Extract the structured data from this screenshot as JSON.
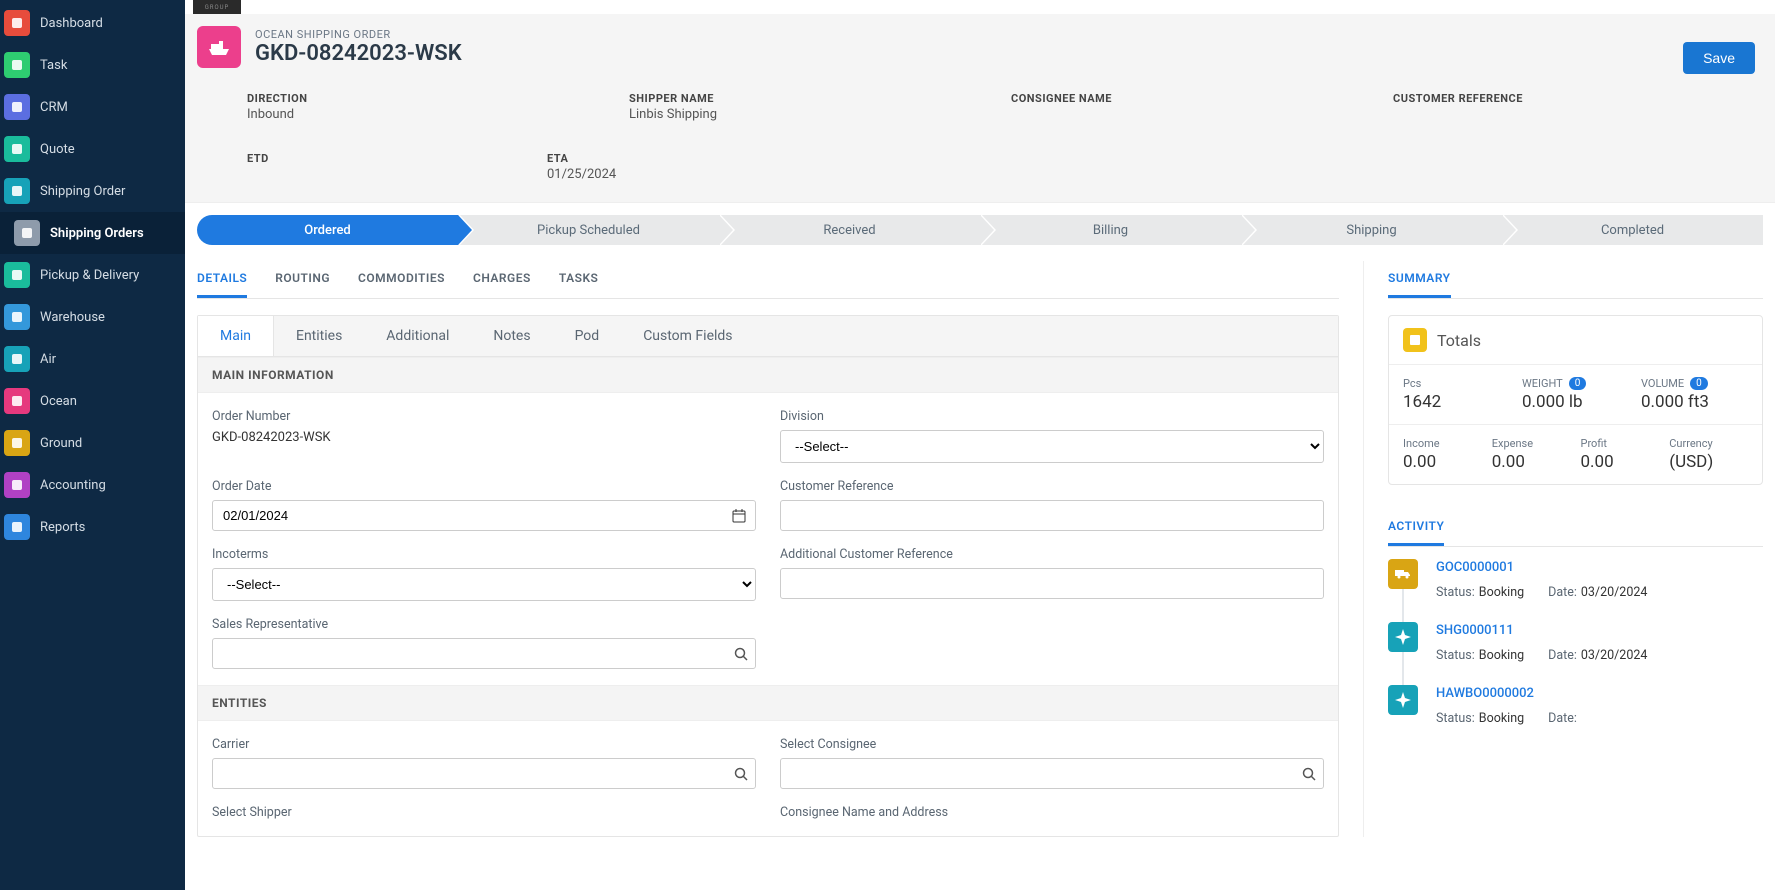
{
  "sidebar": {
    "items": [
      {
        "label": "Dashboard",
        "color": "#e74c3c"
      },
      {
        "label": "Task",
        "color": "#2ecc71"
      },
      {
        "label": "CRM",
        "color": "#5b6ee1"
      },
      {
        "label": "Quote",
        "color": "#1abc9c"
      },
      {
        "label": "Shipping Order",
        "color": "#17a2b8"
      },
      {
        "label": "Shipping Orders",
        "color": "#8e9bab",
        "active": true
      },
      {
        "label": "Pickup & Delivery",
        "color": "#1abc9c"
      },
      {
        "label": "Warehouse",
        "color": "#3498db"
      },
      {
        "label": "Air",
        "color": "#17a2b8"
      },
      {
        "label": "Ocean",
        "color": "#e6397e"
      },
      {
        "label": "Ground",
        "color": "#d9a514"
      },
      {
        "label": "Accounting",
        "color": "#b041c4"
      },
      {
        "label": "Reports",
        "color": "#2e86de"
      }
    ]
  },
  "brand": "GROUP",
  "header": {
    "type": "OCEAN SHIPPING ORDER",
    "number": "GKD-08242023-WSK",
    "save": "Save",
    "fields": {
      "direction_label": "DIRECTION",
      "direction_value": "Inbound",
      "shipper_label": "SHIPPER NAME",
      "shipper_value": "Linbis Shipping",
      "consignee_label": "CONSIGNEE NAME",
      "consignee_value": "",
      "custref_label": "CUSTOMER REFERENCE",
      "custref_value": "",
      "etd_label": "ETD",
      "etd_value": "",
      "eta_label": "ETA",
      "eta_value": "01/25/2024"
    }
  },
  "progress": [
    "Ordered",
    "Pickup Scheduled",
    "Received",
    "Billing",
    "Shipping",
    "Completed"
  ],
  "tabs_upper": [
    "DETAILS",
    "ROUTING",
    "COMMODITIES",
    "CHARGES",
    "TASKS"
  ],
  "tabs_lower": [
    "Main",
    "Entities",
    "Additional",
    "Notes",
    "Pod",
    "Custom Fields"
  ],
  "sections": {
    "main_info": "MAIN INFORMATION",
    "entities": "ENTITIES"
  },
  "form": {
    "order_number_label": "Order Number",
    "order_number_value": "GKD-08242023-WSK",
    "division_label": "Division",
    "division_value": "--Select--",
    "order_date_label": "Order Date",
    "order_date_value": "02/01/2024",
    "custref_label": "Customer Reference",
    "incoterms_label": "Incoterms",
    "incoterms_value": "--Select--",
    "addref_label": "Additional Customer Reference",
    "salesrep_label": "Sales Representative",
    "carrier_label": "Carrier",
    "select_consignee_label": "Select Consignee",
    "select_shipper_label": "Select Shipper",
    "consignee_addr_label": "Consignee Name and Address"
  },
  "summary": {
    "tab": "SUMMARY",
    "totals_title": "Totals",
    "pcs_label": "Pcs",
    "pcs_value": "1642",
    "weight_label": "WEIGHT",
    "weight_badge": "0",
    "weight_value": "0.000 lb",
    "volume_label": "VOLUME",
    "volume_badge": "0",
    "volume_value": "0.000 ft3",
    "income_label": "Income",
    "income_value": "0.00",
    "expense_label": "Expense",
    "expense_value": "0.00",
    "profit_label": "Profit",
    "profit_value": "0.00",
    "currency_label": "Currency",
    "currency_value": "(USD)"
  },
  "activity": {
    "tab": "ACTIVITY",
    "status_k": "Status:",
    "date_k": "Date:",
    "items": [
      {
        "id": "GOC0000001",
        "status": "Booking",
        "date": "03/20/2024",
        "kind": "truck"
      },
      {
        "id": "SHG0000111",
        "status": "Booking",
        "date": "03/20/2024",
        "kind": "plane"
      },
      {
        "id": "HAWBO0000002",
        "status": "Booking",
        "date": "",
        "kind": "plane"
      }
    ]
  }
}
